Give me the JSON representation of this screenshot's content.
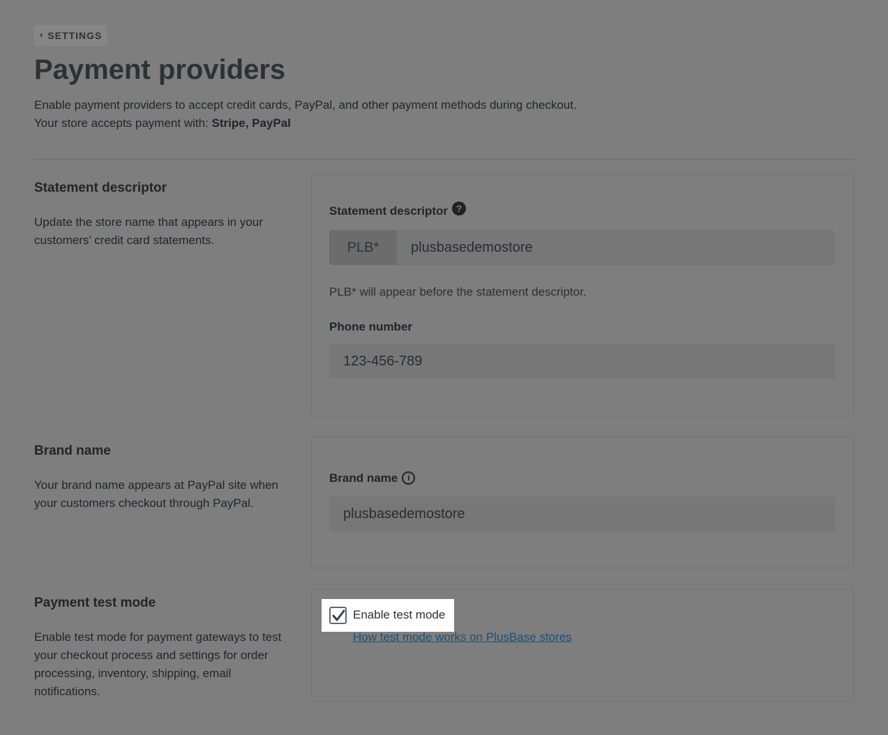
{
  "breadcrumb": {
    "icon": "chevron-left-icon",
    "label": "SETTINGS"
  },
  "page": {
    "title": "Payment providers",
    "intro_line1": "Enable payment providers to accept credit cards, PayPal, and other payment methods during checkout.",
    "intro_line2_prefix": "Your store accepts payment with: ",
    "intro_line2_methods": "Stripe, PayPal"
  },
  "statement": {
    "title": "Statement descriptor",
    "description": "Update the store name that appears in your customers’ credit card statements.",
    "field_label": "Statement descriptor",
    "help_icon": "question-circle-icon",
    "prefix": "PLB*",
    "value": "plusbasedemostore",
    "help_text": "PLB* will appear before the statement descriptor.",
    "phone_label": "Phone number",
    "phone_value": "123-456-789"
  },
  "brand": {
    "title": "Brand name",
    "description": "Your brand name appears at PayPal site when your customers checkout through PayPal.",
    "field_label": "Brand name",
    "info_icon": "info-circle-icon",
    "value": "plusbasedemostore"
  },
  "test_mode": {
    "title": "Payment test mode",
    "description": "Enable test mode for payment gateways to test your checkout process and settings for order processing, inventory, shipping, email notifications.",
    "checkbox_label": "Enable test mode",
    "checked": true,
    "link_text": "How test mode works on PlusBase stores"
  },
  "colors": {
    "background": "#7e7e7e",
    "highlight": "#ffffff",
    "link": "#1e4f74"
  }
}
